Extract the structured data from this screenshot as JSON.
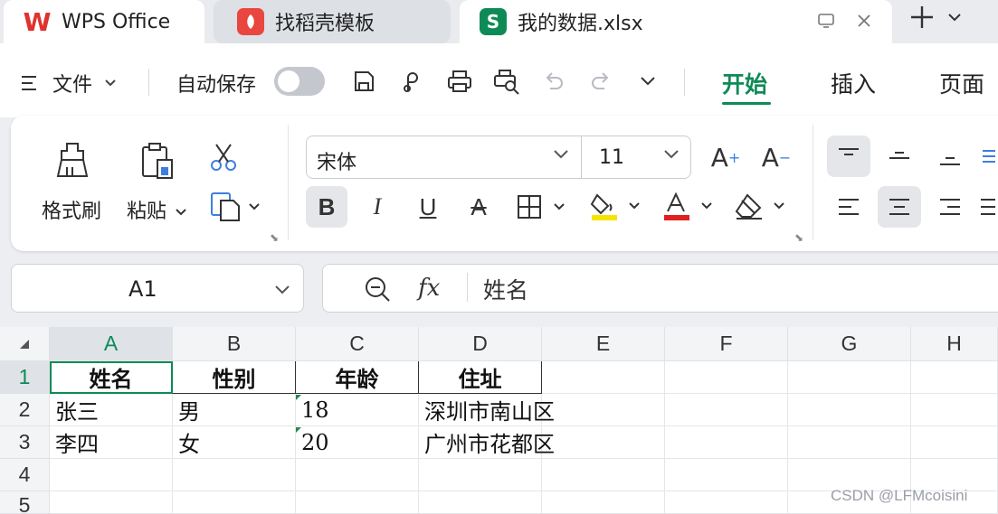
{
  "tabs": {
    "wps": "WPS Office",
    "template": "找稻壳模板",
    "document": "我的数据.xlsx"
  },
  "toolbar": {
    "file_menu": "文件",
    "autosave_label": "自动保存",
    "autosave_on": false
  },
  "ribbon_tabs": [
    {
      "label": "开始",
      "active": true
    },
    {
      "label": "插入",
      "active": false
    },
    {
      "label": "页面",
      "active": false
    }
  ],
  "ribbon": {
    "format_painter": "格式刷",
    "paste": "粘贴",
    "font_name": "宋体",
    "font_size": "11"
  },
  "formula_bar": {
    "name_box": "A1",
    "fx_symbol": "fx",
    "content": "姓名"
  },
  "sheet": {
    "columns": [
      "A",
      "B",
      "C",
      "D",
      "E",
      "F",
      "G",
      "H"
    ],
    "rows": [
      "1",
      "2",
      "3",
      "4",
      "5"
    ],
    "active_cell": "A1",
    "cells": [
      [
        "姓名",
        "性别",
        "年龄",
        "住址"
      ],
      [
        "张三",
        "男",
        "18",
        "深圳市南山区"
      ],
      [
        "李四",
        "女",
        "20",
        "广州市花都区"
      ]
    ]
  },
  "watermark": "CSDN @LFMcoisini",
  "colors": {
    "accent": "#0e8a57",
    "wps_red": "#e0312e",
    "highlight_yellow": "#f5e400",
    "font_red": "#e02020"
  }
}
